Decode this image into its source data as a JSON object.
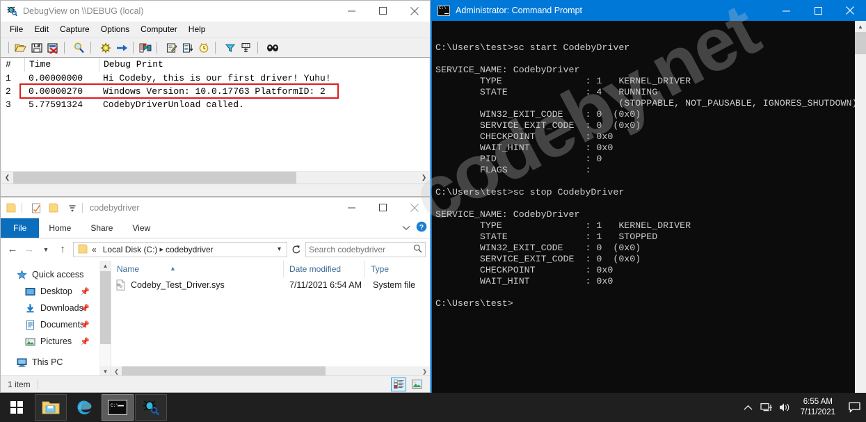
{
  "debugview": {
    "title": "DebugView on \\\\DEBUG (local)",
    "icon": "bug-magnifier-icon",
    "menu": [
      "File",
      "Edit",
      "Capture",
      "Options",
      "Computer",
      "Help"
    ],
    "toolbar_icons": [
      "open-folder-icon",
      "save-icon",
      "clear-window-icon",
      "find-icon",
      "capture-win32-icon",
      "capture-kernel-icon",
      "capture-events-icon",
      "highlight-filter-icon",
      "log-to-file-icon",
      "clock-icon",
      "filter-icon",
      "history-depth-icon",
      "find-highlight-icon"
    ],
    "columns": [
      "#",
      "Time",
      "Debug Print"
    ],
    "rows": [
      {
        "n": "1",
        "time": "0.00000000",
        "text": "Hi Codeby, this is our first driver! Yuhu!",
        "highlighted": false
      },
      {
        "n": "2",
        "time": "0.00000270",
        "text": "Windows Version: 10.0.17763   PlatformID: 2",
        "highlighted": true
      },
      {
        "n": "3",
        "time": "5.77591324",
        "text": "CodebyDriverUnload called.",
        "highlighted": false
      }
    ],
    "highlight_color": "#e01b1b",
    "window_buttons": [
      "minimize",
      "maximize",
      "close"
    ]
  },
  "explorer": {
    "title": "codebydriver",
    "quick_icons": [
      "folder-icon",
      "properties-icon",
      "new-folder-icon",
      "customize-dropdown-icon"
    ],
    "ribbon_tabs": [
      "File",
      "Home",
      "Share",
      "View"
    ],
    "ribbon_right_icons": [
      "chevron-down-icon",
      "help-icon"
    ],
    "nav_buttons": [
      "back-arrow-icon",
      "forward-arrow-icon",
      "recent-locations-icon",
      "up-arrow-icon"
    ],
    "breadcrumb": [
      "Local Disk (C:)",
      "codebydriver"
    ],
    "breadcrumb_prefix": "«",
    "refresh_icon": "refresh-icon",
    "search": {
      "placeholder": "Search codebydriver",
      "value": "Search codebydriver",
      "icon": "search-icon"
    },
    "nav_pane": [
      {
        "label": "Quick access",
        "icon": "star-icon",
        "pinned": false,
        "indent": false
      },
      {
        "label": "Desktop",
        "icon": "desktop-icon",
        "pinned": true,
        "indent": true
      },
      {
        "label": "Downloads",
        "icon": "download-icon",
        "pinned": true,
        "indent": true
      },
      {
        "label": "Documents",
        "icon": "documents-icon",
        "pinned": true,
        "indent": true
      },
      {
        "label": "Pictures",
        "icon": "pictures-icon",
        "pinned": true,
        "indent": true
      },
      {
        "label": "This PC",
        "icon": "this-pc-icon",
        "pinned": false,
        "indent": false
      }
    ],
    "columns": [
      "Name",
      "Date modified",
      "Type"
    ],
    "sort_column": "Name",
    "files": [
      {
        "name": "Codeby_Test_Driver.sys",
        "date_modified": "7/11/2021 6:54 AM",
        "type": "System file",
        "icon": "sys-file-icon"
      }
    ],
    "status": "1 item",
    "view_buttons": [
      "details-view-icon",
      "large-icons-view-icon"
    ],
    "selected_view": "details-view-icon",
    "window_buttons": [
      "minimize",
      "maximize",
      "close"
    ]
  },
  "cmd": {
    "title": "Administrator: Command Prompt",
    "icon": "console-icon",
    "accent_color": "#0078d7",
    "background": "#0c0c0c",
    "text_color": "#cccccc",
    "window_buttons": [
      "minimize",
      "maximize",
      "close"
    ],
    "console_text": "C:\\Users\\test>sc start CodebyDriver\n\nSERVICE_NAME: CodebyDriver\n        TYPE               : 1   KERNEL_DRIVER\n        STATE              : 4   RUNNING\n                                 (STOPPABLE, NOT_PAUSABLE, IGNORES_SHUTDOWN)\n        WIN32_EXIT_CODE    : 0  (0x0)\n        SERVICE_EXIT_CODE  : 0  (0x0)\n        CHECKPOINT         : 0x0\n        WAIT_HINT          : 0x0\n        PID                : 0\n        FLAGS              :\n\nC:\\Users\\test>sc stop CodebyDriver\n\nSERVICE_NAME: CodebyDriver\n        TYPE               : 1   KERNEL_DRIVER\n        STATE              : 1   STOPPED\n        WIN32_EXIT_CODE    : 0  (0x0)\n        SERVICE_EXIT_CODE  : 0  (0x0)\n        CHECKPOINT         : 0x0\n        WAIT_HINT          : 0x0\n\nC:\\Users\\test>"
  },
  "taskbar": {
    "start_icon": "windows-start-icon",
    "tasks": [
      {
        "name": "file-explorer-taskbar-icon",
        "state": "open"
      },
      {
        "name": "internet-explorer-taskbar-icon",
        "state": "idle"
      },
      {
        "name": "command-prompt-taskbar-icon",
        "state": "active"
      },
      {
        "name": "debugview-taskbar-icon",
        "state": "open"
      }
    ],
    "tray_icons": [
      "show-hidden-icons-chevron",
      "network-icon",
      "volume-icon"
    ],
    "clock_time": "6:55 AM",
    "clock_date": "7/11/2021",
    "action_center_icon": "action-center-icon"
  },
  "watermark": {
    "text": "codeby.net",
    "color": "#c8c8c8"
  }
}
